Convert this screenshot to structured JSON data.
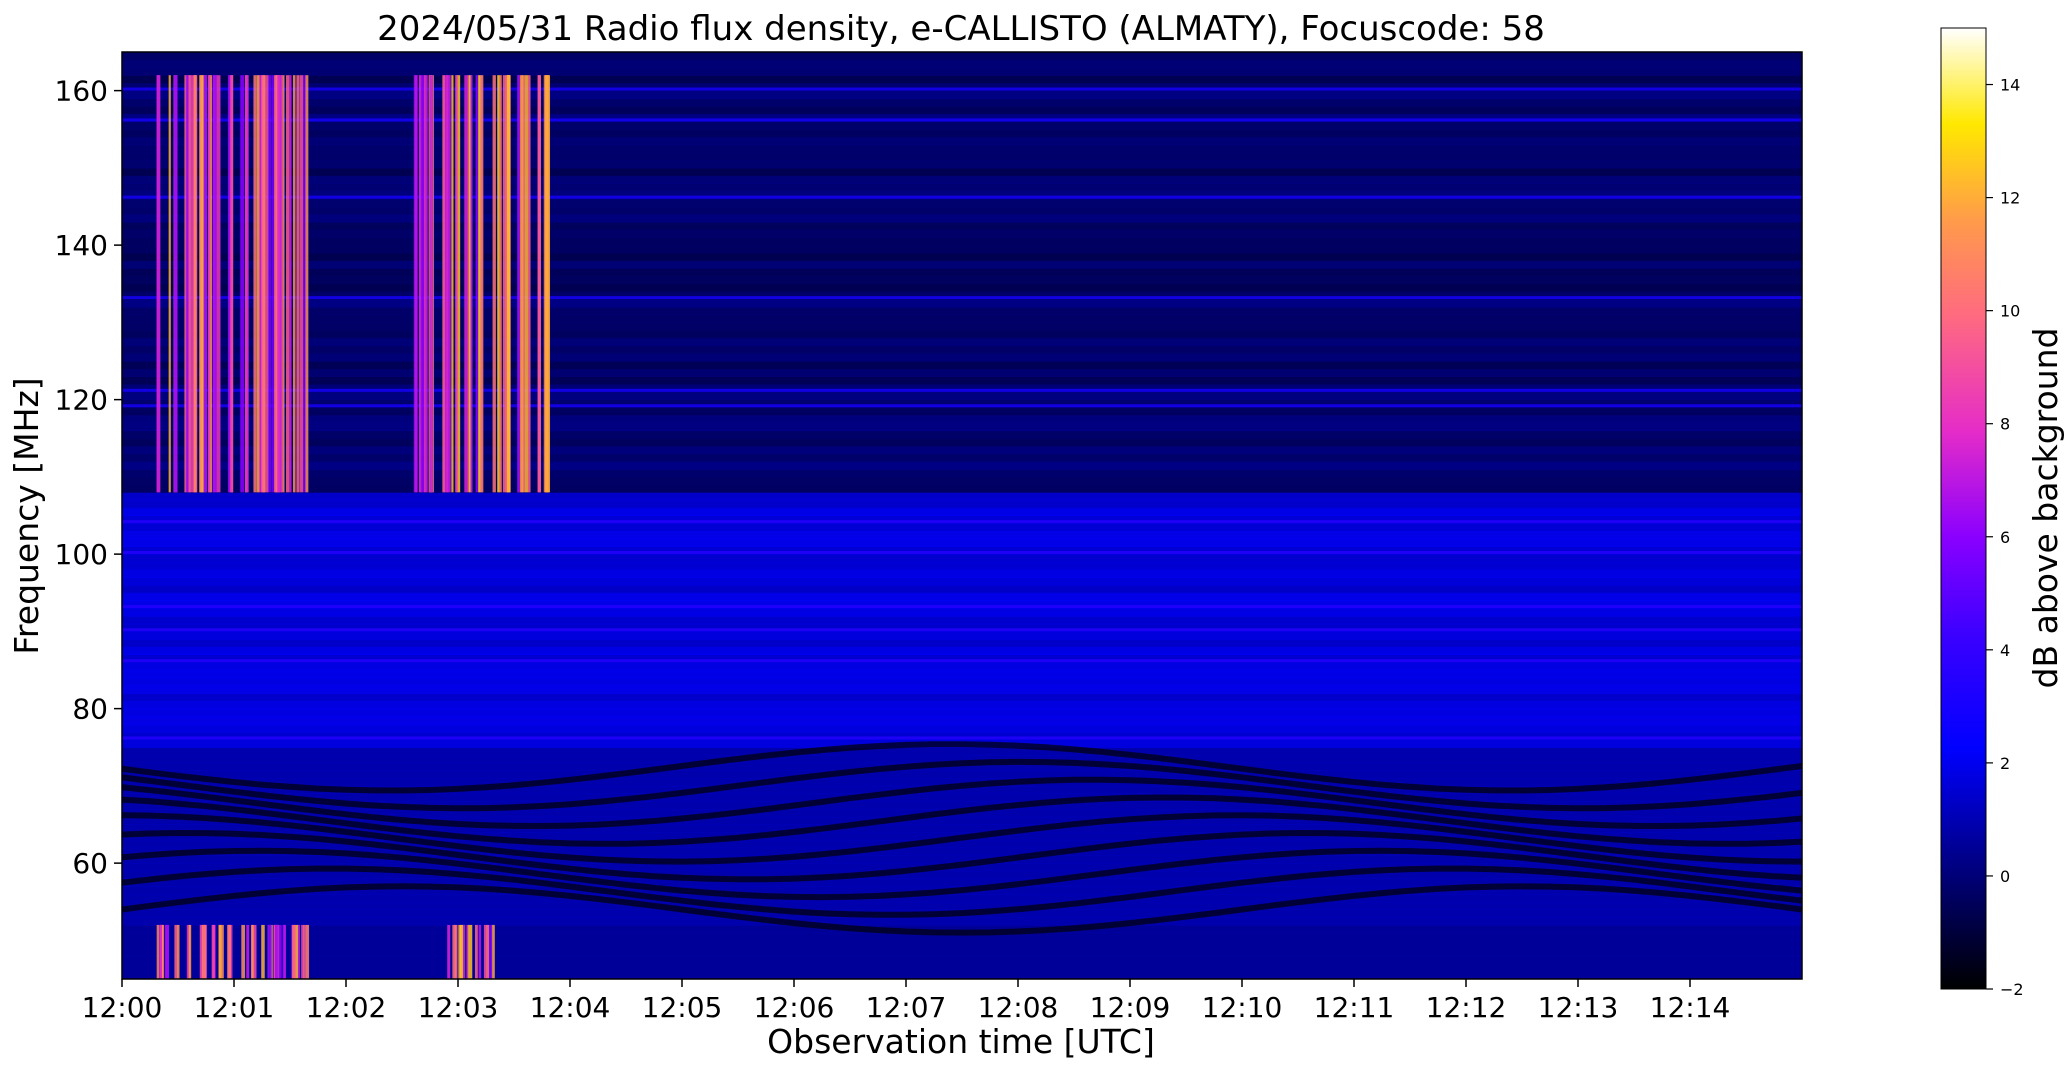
{
  "chart_data": {
    "type": "heatmap",
    "title": "2024/05/31  Radio flux density, e-CALLISTO (ALMATY), Focuscode: 58",
    "xlabel": "Observation time [UTC]",
    "ylabel": "Frequency [MHz]",
    "x_range": [
      "12:00",
      "12:15"
    ],
    "ylim": [
      45,
      165
    ],
    "x_ticks": [
      "12:00",
      "12:01",
      "12:02",
      "12:03",
      "12:04",
      "12:05",
      "12:06",
      "12:07",
      "12:08",
      "12:09",
      "12:10",
      "12:11",
      "12:12",
      "12:13",
      "12:14"
    ],
    "y_ticks": [
      60,
      80,
      100,
      120,
      140,
      160
    ],
    "colorbar": {
      "label": "dB above background",
      "range": [
        -2,
        15
      ],
      "ticks": [
        -2,
        0,
        2,
        4,
        6,
        8,
        10,
        12,
        14
      ],
      "colormap": "gnuplot2"
    },
    "bursts": [
      {
        "start_min": 0.3,
        "end_min": 1.65,
        "freq_range": [
          108,
          162
        ],
        "intensity_db": 12
      },
      {
        "start_min": 2.6,
        "end_min": 3.8,
        "freq_range": [
          108,
          162
        ],
        "intensity_db": 13
      },
      {
        "start_min": 0.3,
        "end_min": 1.65,
        "freq_range": [
          45,
          52
        ],
        "intensity_db": 12
      },
      {
        "start_min": 2.9,
        "end_min": 3.3,
        "freq_range": [
          45,
          52
        ],
        "intensity_db": 12
      }
    ],
    "interference_bands_mhz": [
      160,
      156,
      146,
      133,
      121,
      119,
      104,
      100,
      93,
      90,
      86,
      76
    ],
    "grid": false
  }
}
